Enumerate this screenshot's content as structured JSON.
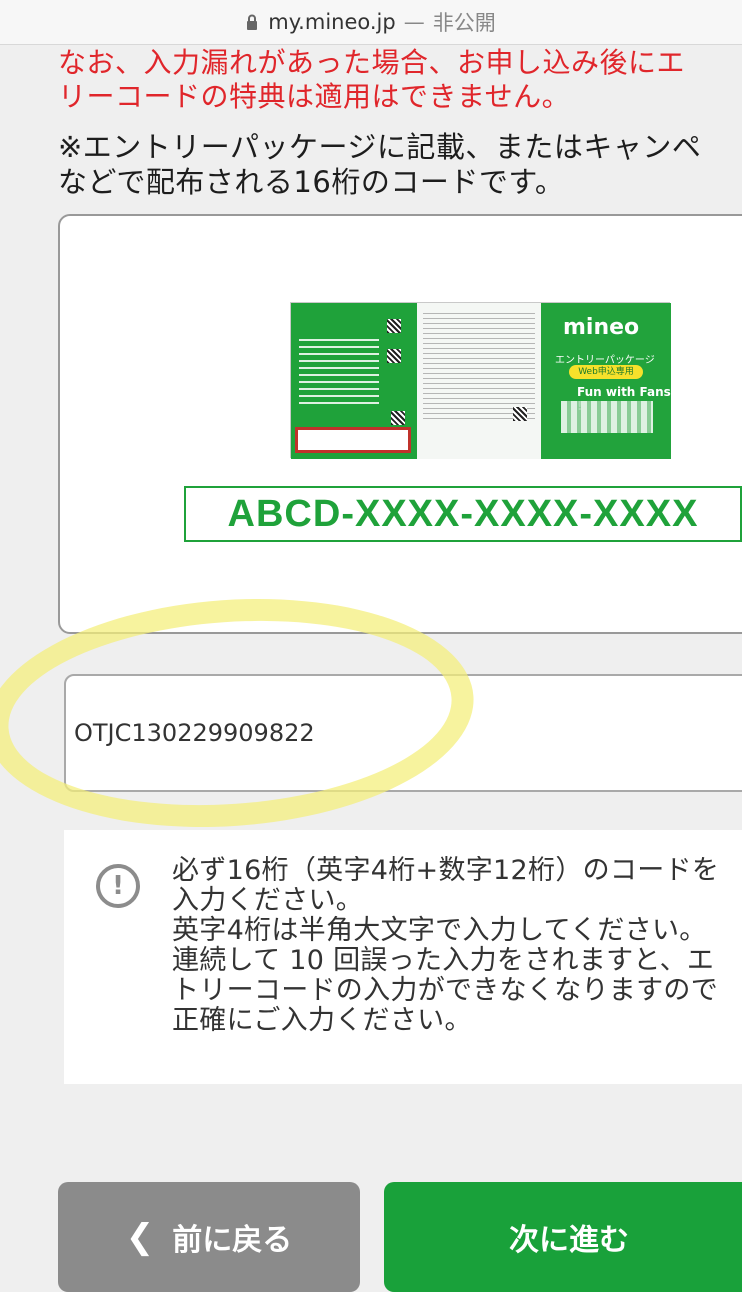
{
  "browser": {
    "domain": "my.mineo.jp",
    "separator": "—",
    "visibility": "非公開"
  },
  "warning_lines": [
    "なお、入力漏れがあった場合、お申し込み後にエ",
    "リーコードの特典は適用はできません。"
  ],
  "note_lines": [
    "※エントリーパッケージに記載、またはキャンペ",
    "などで配布される16桁のコードです。"
  ],
  "package": {
    "logo": "mineo",
    "title": "エントリーパッケージ",
    "web_badge": "Web申込専用",
    "fans": "Fun with Fans !"
  },
  "code_example": "ABCD-XXXX-XXXX-XXXX",
  "entry_input": {
    "value": "OTJC130229909822"
  },
  "info": {
    "icon": "exclamation-circle-icon",
    "lines": [
      "必ず16桁（英字4桁+数字12桁）のコードを",
      "入力ください。",
      "英字4桁は半角大文字で入力してください。",
      "連続して 10 回誤った入力をされますと、エ",
      "トリーコードの入力ができなくなりますので",
      "正確にご入力ください。"
    ]
  },
  "buttons": {
    "back": "前に戻る",
    "back_icon": "chevron-left-icon",
    "next": "次に進む"
  },
  "colors": {
    "brand_green": "#1fa23a",
    "warning_red": "#e0262b",
    "highlight_yellow": "#f4ee78"
  }
}
